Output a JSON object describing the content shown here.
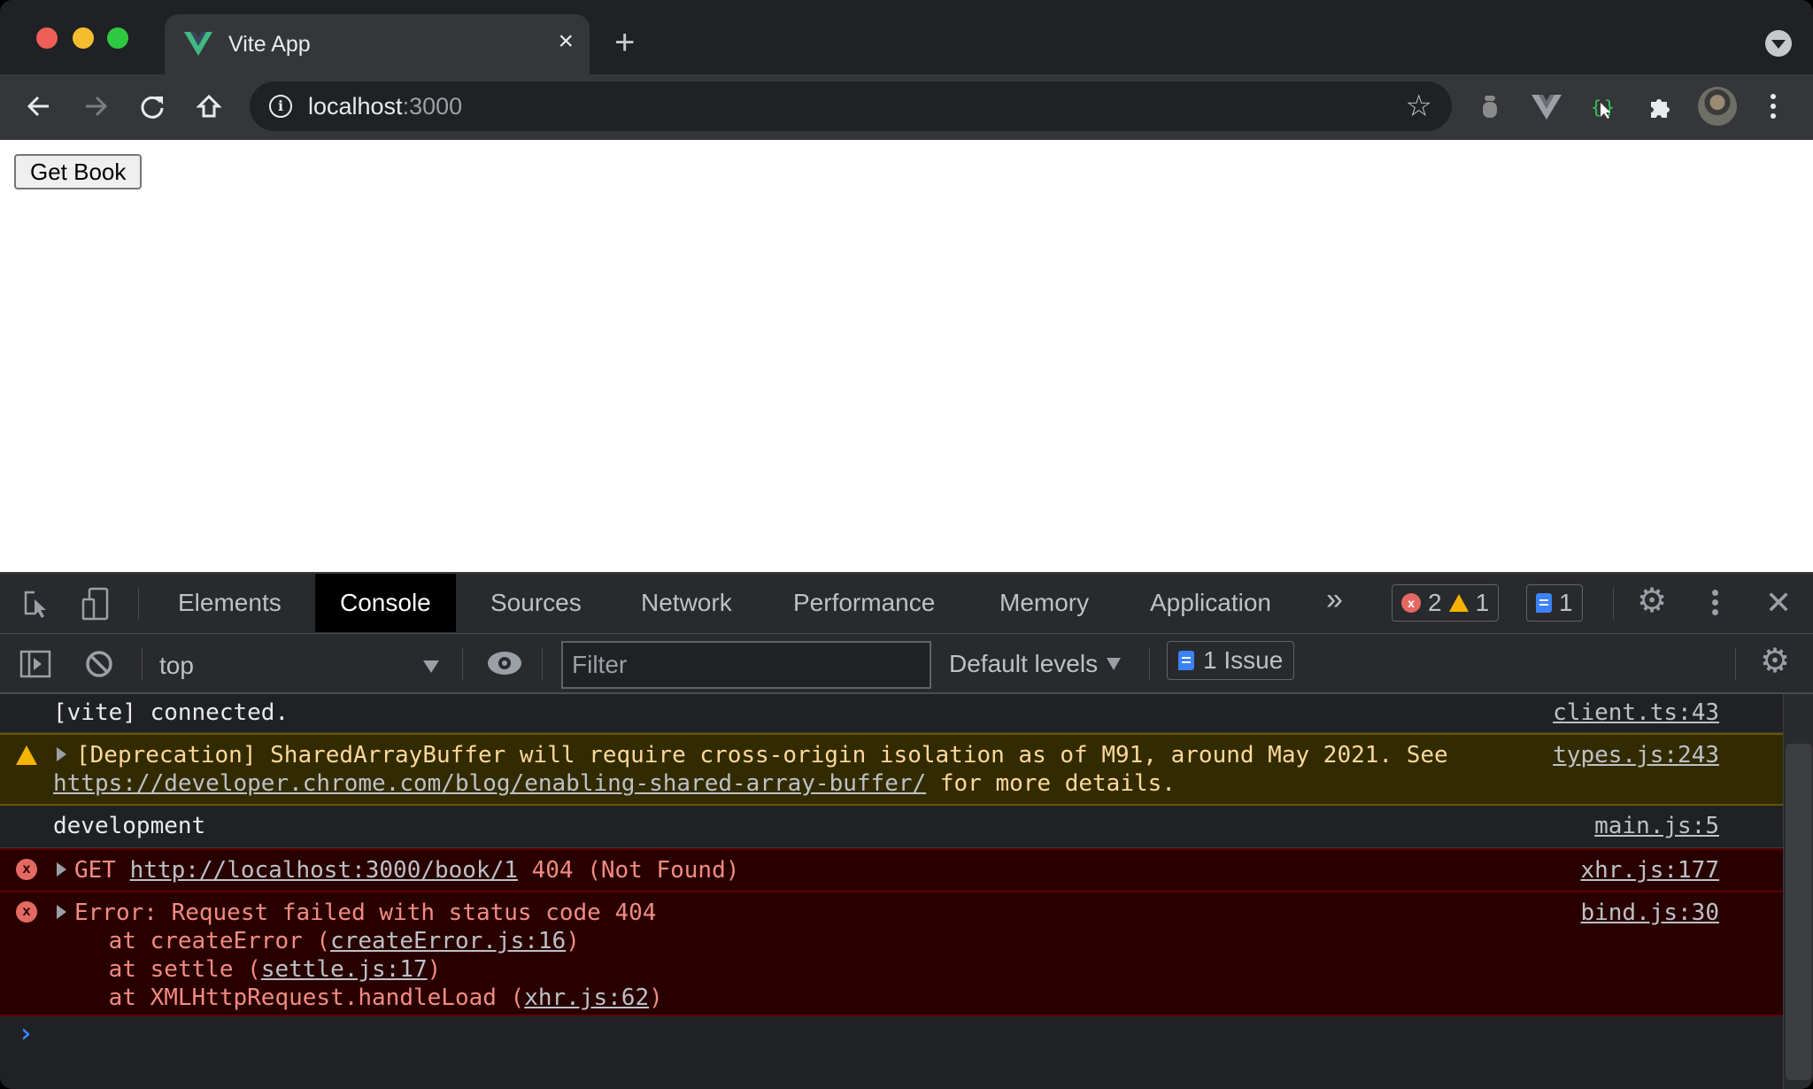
{
  "browser": {
    "tab": {
      "title": "Vite App",
      "close_label": "×"
    },
    "new_tab_label": "+",
    "address": {
      "host": "localhost",
      "port": ":3000"
    },
    "extensions": [
      "bug-extension",
      "vue-devtools-extension",
      "json-viewer-extension",
      "extensions-puzzle"
    ]
  },
  "page": {
    "get_book_button": "Get Book"
  },
  "devtools": {
    "tabs": [
      {
        "label": "Elements",
        "active": false
      },
      {
        "label": "Console",
        "active": true
      },
      {
        "label": "Sources",
        "active": false
      },
      {
        "label": "Network",
        "active": false
      },
      {
        "label": "Performance",
        "active": false
      },
      {
        "label": "Memory",
        "active": false
      },
      {
        "label": "Application",
        "active": false
      }
    ],
    "more_tabs_label": "»",
    "counts": {
      "errors": "2",
      "warnings": "1",
      "issues": "1"
    },
    "close_label": "✕",
    "console_toolbar": {
      "context": "top",
      "filter_placeholder": "Filter",
      "levels": "Default levels",
      "issues_label": "1 Issue"
    },
    "messages": [
      {
        "type": "log",
        "text": "[vite] connected.",
        "source": "client.ts:43"
      },
      {
        "type": "warning",
        "text": "[Deprecation] SharedArrayBuffer will require cross-origin isolation as of M91, around May 2021. See",
        "link": "https://developer.chrome.com/blog/enabling-shared-array-buffer/",
        "text_after": " for more details.",
        "source": "types.js:243"
      },
      {
        "type": "log",
        "text": "development",
        "source": "main.js:5"
      },
      {
        "type": "error",
        "prefix": "GET ",
        "link": "http://localhost:3000/book/1",
        "suffix": " 404 (Not Found)",
        "source": "xhr.js:177"
      },
      {
        "type": "error",
        "text": "Error: Request failed with status code 404",
        "stack": [
          {
            "prefix": "    at createError (",
            "link": "createError.js:16",
            "suffix": ")"
          },
          {
            "prefix": "    at settle (",
            "link": "settle.js:17",
            "suffix": ")"
          },
          {
            "prefix": "    at XMLHttpRequest.handleLoad (",
            "link": "xhr.js:62",
            "suffix": ")"
          }
        ],
        "source": "bind.js:30"
      }
    ],
    "prompt": "›"
  },
  "colors": {
    "vue_green": "#42b883",
    "error_red": "#e46962",
    "warning_yellow": "#f4b400",
    "issue_blue": "#3b82f6"
  }
}
